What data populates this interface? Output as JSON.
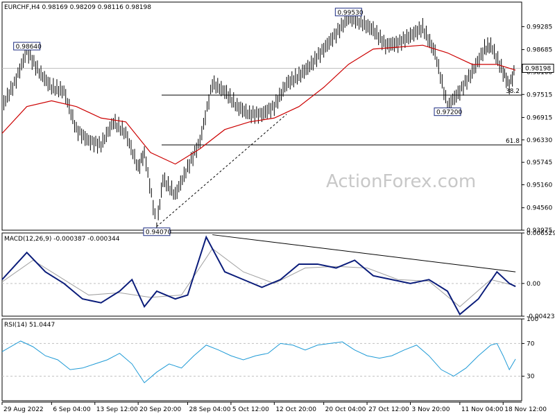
{
  "chart_data": {
    "type": "candlestick-with-indicators",
    "watermark": "ActionForex.com",
    "price": {
      "header": "EURCHF,H4  0.98169 0.98209 0.98116 0.98198",
      "ylim": [
        0.93975,
        0.99925
      ],
      "y_ticks": [
        "0.99285",
        "0.98685",
        "0.98100",
        "0.97515",
        "0.96915",
        "0.96330",
        "0.95745",
        "0.95160",
        "0.94560",
        "0.93975"
      ],
      "current_price": "0.98198",
      "price_series": {
        "name": "EURCHF",
        "points": [
          [
            "29 Aug 2022",
            0.972
          ],
          [
            "31 Aug 2022",
            0.978
          ],
          [
            "2 Sep 2022",
            0.9864
          ],
          [
            "4 Sep 2022",
            0.981
          ],
          [
            "6 Sep 2022",
            0.977
          ],
          [
            "8 Sep 2022",
            0.976
          ],
          [
            "10 Sep 2022",
            0.966
          ],
          [
            "12 Sep 2022",
            0.963
          ],
          [
            "14 Sep 2022",
            0.962
          ],
          [
            "16 Sep 2022",
            0.968
          ],
          [
            "18 Sep 2022",
            0.965
          ],
          [
            "20 Sep 2022",
            0.956
          ],
          [
            "21 Sep 2022",
            0.96
          ],
          [
            "23 Sep 2022",
            0.9407
          ],
          [
            "24 Sep 2022",
            0.953
          ],
          [
            "26 Sep 2022",
            0.949
          ],
          [
            "28 Sep 2022",
            0.956
          ],
          [
            "30 Sep 2022",
            0.963
          ],
          [
            "2 Oct 2022",
            0.978
          ],
          [
            "4 Oct 2022",
            0.976
          ],
          [
            "6 Oct 2022",
            0.972
          ],
          [
            "8 Oct 2022",
            0.97
          ],
          [
            "10 Oct 2022",
            0.97
          ],
          [
            "12 Oct 2022",
            0.972
          ],
          [
            "14 Oct 2022",
            0.978
          ],
          [
            "16 Oct 2022",
            0.98
          ],
          [
            "18 Oct 2022",
            0.983
          ],
          [
            "20 Oct 2022",
            0.987
          ],
          [
            "22 Oct 2022",
            0.991
          ],
          [
            "24 Oct 2022",
            0.9953
          ],
          [
            "26 Oct 2022",
            0.994
          ],
          [
            "28 Oct 2022",
            0.992
          ],
          [
            "30 Oct 2022",
            0.988
          ],
          [
            "1 Nov 2022",
            0.9885
          ],
          [
            "3 Nov 2022",
            0.9905
          ],
          [
            "5 Nov 2022",
            0.9925
          ],
          [
            "7 Nov 2022",
            0.986
          ],
          [
            "9 Nov 2022",
            0.972
          ],
          [
            "11 Nov 2022",
            0.976
          ],
          [
            "13 Nov 2022",
            0.981
          ],
          [
            "15 Nov 2022",
            0.987
          ],
          [
            "16 Nov 2022",
            0.988
          ],
          [
            "18 Nov 2022",
            0.981
          ],
          [
            "19 Nov 2022",
            0.9775
          ],
          [
            "20 Nov 2022",
            0.982
          ]
        ]
      },
      "ma_series": {
        "name": "MA",
        "color": "#cc0000",
        "points": [
          [
            "29 Aug 2022",
            0.965
          ],
          [
            "2 Sep 2022",
            0.972
          ],
          [
            "6 Sep 2022",
            0.9735
          ],
          [
            "10 Sep 2022",
            0.972
          ],
          [
            "14 Sep 2022",
            0.969
          ],
          [
            "18 Sep 2022",
            0.968
          ],
          [
            "22 Sep 2022",
            0.96
          ],
          [
            "26 Sep 2022",
            0.957
          ],
          [
            "30 Sep 2022",
            0.961
          ],
          [
            "4 Oct 2022",
            0.966
          ],
          [
            "8 Oct 2022",
            0.968
          ],
          [
            "12 Oct 2022",
            0.969
          ],
          [
            "16 Oct 2022",
            0.972
          ],
          [
            "20 Oct 2022",
            0.977
          ],
          [
            "24 Oct 2022",
            0.983
          ],
          [
            "28 Oct 2022",
            0.987
          ],
          [
            "1 Nov 2022",
            0.9875
          ],
          [
            "5 Nov 2022",
            0.988
          ],
          [
            "9 Nov 2022",
            0.986
          ],
          [
            "13 Nov 2022",
            0.983
          ],
          [
            "17 Nov 2022",
            0.983
          ],
          [
            "20 Nov 2022",
            0.9815
          ]
        ]
      },
      "fib_levels": [
        {
          "label": "38.2",
          "value": 0.975
        },
        {
          "label": "61.8",
          "value": 0.962
        }
      ],
      "price_labels": [
        {
          "text": "0.98640",
          "date": "2 Sep 2022",
          "value": 0.9864
        },
        {
          "text": "0.94070",
          "date": "23 Sep 2022",
          "value": 0.9407
        },
        {
          "text": "0.99530",
          "date": "24 Oct 2022",
          "value": 0.9953
        },
        {
          "text": "0.97200",
          "date": "9 Nov 2022",
          "value": 0.972
        }
      ],
      "trendline": {
        "from": [
          "23 Sep 2022",
          0.9407
        ],
        "to": [
          "14 Oct 2022",
          0.97
        ]
      }
    },
    "macd": {
      "header": "MACD(12,26,9) -0.000387 -0.000344",
      "ylim": [
        -0.00423,
        0.00653
      ],
      "y_ticks": [
        "0.006529",
        "0.00",
        "-0.004233"
      ],
      "current_label": "0.00",
      "values": [
        [
          "29 Aug 2022",
          0.0005
        ],
        [
          "2 Sep 2022",
          0.004
        ],
        [
          "5 Sep 2022",
          0.0015
        ],
        [
          "8 Sep 2022",
          0.0
        ],
        [
          "11 Sep 2022",
          -0.002
        ],
        [
          "14 Sep 2022",
          -0.0025
        ],
        [
          "17 Sep 2022",
          -0.001
        ],
        [
          "19 Sep 2022",
          0.0005
        ],
        [
          "21 Sep 2022",
          -0.003
        ],
        [
          "23 Sep 2022",
          -0.001
        ],
        [
          "26 Sep 2022",
          -0.002
        ],
        [
          "28 Sep 2022",
          -0.0015
        ],
        [
          "1 Oct 2022",
          0.006
        ],
        [
          "4 Oct 2022",
          0.0015
        ],
        [
          "7 Oct 2022",
          0.0005
        ],
        [
          "10 Oct 2022",
          -0.0005
        ],
        [
          "13 Oct 2022",
          0.0005
        ],
        [
          "16 Oct 2022",
          0.0025
        ],
        [
          "19 Oct 2022",
          0.0025
        ],
        [
          "22 Oct 2022",
          0.002
        ],
        [
          "25 Oct 2022",
          0.003
        ],
        [
          "28 Oct 2022",
          0.001
        ],
        [
          "31 Oct 2022",
          0.0005
        ],
        [
          "3 Nov 2022",
          0.0
        ],
        [
          "6 Nov 2022",
          0.0005
        ],
        [
          "9 Nov 2022",
          -0.001
        ],
        [
          "11 Nov 2022",
          -0.004
        ],
        [
          "14 Nov 2022",
          -0.002
        ],
        [
          "17 Nov 2022",
          0.0015
        ],
        [
          "19 Nov 2022",
          0.0
        ],
        [
          "20 Nov 2022",
          -0.0004
        ]
      ],
      "signal_values": [
        [
          "29 Aug 2022",
          0.0002
        ],
        [
          "3 Sep 2022",
          0.003
        ],
        [
          "7 Sep 2022",
          0.001
        ],
        [
          "12 Sep 2022",
          -0.0015
        ],
        [
          "17 Sep 2022",
          -0.0012
        ],
        [
          "22 Sep 2022",
          -0.0018
        ],
        [
          "27 Sep 2022",
          -0.0015
        ],
        [
          "2 Oct 2022",
          0.0045
        ],
        [
          "7 Oct 2022",
          0.0015
        ],
        [
          "12 Oct 2022",
          0.0
        ],
        [
          "17 Oct 2022",
          0.002
        ],
        [
          "22 Oct 2022",
          0.0022
        ],
        [
          "27 Oct 2022",
          0.002
        ],
        [
          "1 Nov 2022",
          0.0005
        ],
        [
          "6 Nov 2022",
          0.0003
        ],
        [
          "11 Nov 2022",
          -0.003
        ],
        [
          "16 Nov 2022",
          0.0005
        ],
        [
          "20 Nov 2022",
          -0.0003
        ]
      ],
      "trendline": {
        "from": [
          "2 Oct 2022",
          0.0063
        ],
        "to": [
          "20 Nov 2022",
          0.0015
        ]
      }
    },
    "rsi": {
      "header": "RSI(14) 51.0447",
      "ylim": [
        0,
        100
      ],
      "y_ticks": [
        "100",
        "70",
        "30"
      ],
      "levels": [
        70,
        30
      ],
      "values": [
        [
          "29 Aug 2022",
          60
        ],
        [
          "1 Sep 2022",
          73
        ],
        [
          "3 Sep 2022",
          66
        ],
        [
          "5 Sep 2022",
          55
        ],
        [
          "7 Sep 2022",
          50
        ],
        [
          "9 Sep 2022",
          38
        ],
        [
          "11 Sep 2022",
          40
        ],
        [
          "13 Sep 2022",
          45
        ],
        [
          "15 Sep 2022",
          50
        ],
        [
          "17 Sep 2022",
          58
        ],
        [
          "19 Sep 2022",
          45
        ],
        [
          "21 Sep 2022",
          22
        ],
        [
          "23 Sep 2022",
          35
        ],
        [
          "25 Sep 2022",
          45
        ],
        [
          "27 Sep 2022",
          40
        ],
        [
          "29 Sep 2022",
          55
        ],
        [
          "1 Oct 2022",
          68
        ],
        [
          "3 Oct 2022",
          62
        ],
        [
          "5 Oct 2022",
          55
        ],
        [
          "7 Oct 2022",
          50
        ],
        [
          "9 Oct 2022",
          55
        ],
        [
          "11 Oct 2022",
          58
        ],
        [
          "13 Oct 2022",
          70
        ],
        [
          "15 Oct 2022",
          68
        ],
        [
          "17 Oct 2022",
          62
        ],
        [
          "19 Oct 2022",
          68
        ],
        [
          "21 Oct 2022",
          70
        ],
        [
          "23 Oct 2022",
          72
        ],
        [
          "25 Oct 2022",
          62
        ],
        [
          "27 Oct 2022",
          55
        ],
        [
          "29 Oct 2022",
          52
        ],
        [
          "31 Oct 2022",
          55
        ],
        [
          "2 Nov 2022",
          62
        ],
        [
          "4 Nov 2022",
          68
        ],
        [
          "6 Nov 2022",
          55
        ],
        [
          "8 Nov 2022",
          38
        ],
        [
          "10 Nov 2022",
          30
        ],
        [
          "12 Nov 2022",
          40
        ],
        [
          "14 Nov 2022",
          55
        ],
        [
          "16 Nov 2022",
          68
        ],
        [
          "17 Nov 2022",
          70
        ],
        [
          "18 Nov 2022",
          55
        ],
        [
          "19 Nov 2022",
          38
        ],
        [
          "20 Nov 2022",
          51
        ]
      ]
    },
    "x_range": [
      "29 Aug 2022",
      "21 Nov 2022"
    ],
    "x_ticks": [
      {
        "label": "29 Aug 2022",
        "date": "29 Aug 2022"
      },
      {
        "label": "6 Sep 04:00",
        "date": "6 Sep 2022"
      },
      {
        "label": "13 Sep 12:00",
        "date": "13 Sep 2022"
      },
      {
        "label": "20 Sep 20:00",
        "date": "20 Sep 2022"
      },
      {
        "label": "28 Sep 04:00",
        "date": "28 Sep 2022"
      },
      {
        "label": "5 Oct 12:00",
        "date": "5 Oct 2022"
      },
      {
        "label": "12 Oct 20:00",
        "date": "12 Oct 2022"
      },
      {
        "label": "20 Oct 04:00",
        "date": "20 Oct 2022"
      },
      {
        "label": "27 Oct 12:00",
        "date": "27 Oct 2022"
      },
      {
        "label": "3 Nov 20:00",
        "date": "3 Nov 2022"
      },
      {
        "label": "11 Nov 04:00",
        "date": "11 Nov 2022"
      },
      {
        "label": "18 Nov 12:00",
        "date": "18 Nov 2022"
      }
    ],
    "colors": {
      "price": "#000000",
      "ma": "#cc0000",
      "macd": "#0a1c7a",
      "signal": "#a0a0a0",
      "label_border": "#1a2a80"
    }
  }
}
